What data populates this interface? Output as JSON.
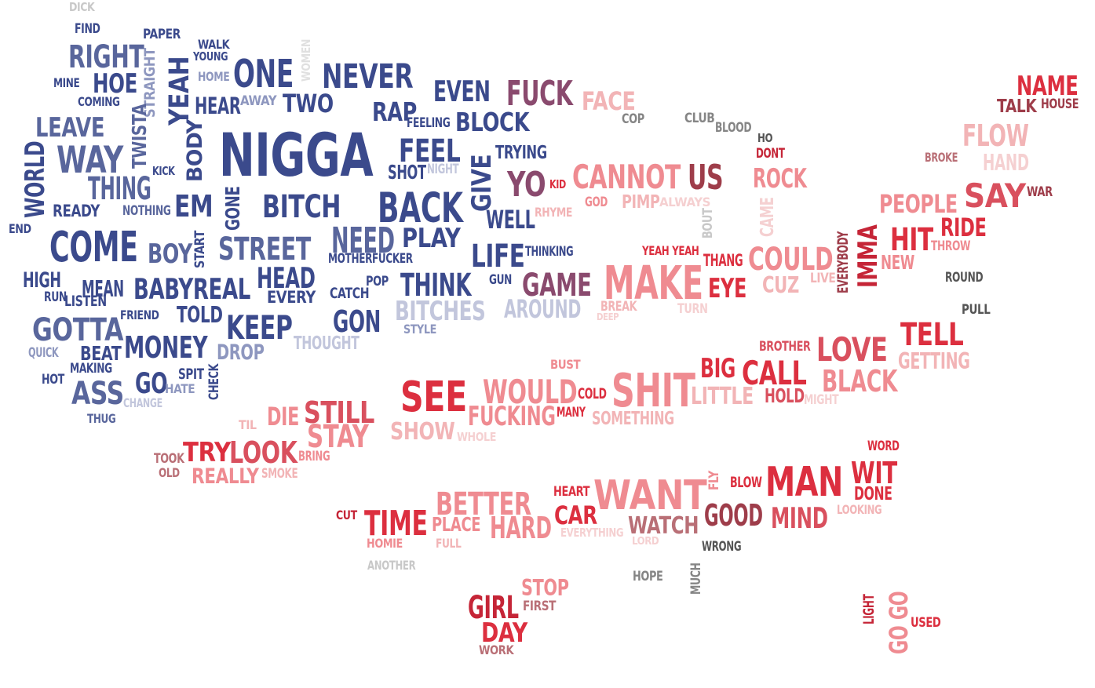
{
  "colors": {
    "navy": "#3b4a8c",
    "navy_mid": "#59669c",
    "navy_light": "#8e97bf",
    "navy_pale": "#c2c6dc",
    "plum": "#8a4a6e",
    "red": "#dc2f3f",
    "crimson": "#c52537",
    "red_mid": "#d9505e",
    "pink": "#ef8b91",
    "pink_light": "#f2b4b6",
    "pink_pale": "#f5d0d1",
    "maroon": "#9e3d4a",
    "rose_gray": "#b96f76",
    "gray": "#858585",
    "gray_dark": "#555555",
    "gray_light": "#c8c8c8",
    "gray_pale": "#e0e0e0"
  },
  "words": [
    {
      "id": "dick",
      "text": "DICK",
      "c": "gray_light"
    },
    {
      "id": "find",
      "text": "FIND",
      "c": "navy"
    },
    {
      "id": "paper",
      "text": "PAPER",
      "c": "navy"
    },
    {
      "id": "walk",
      "text": "WALK",
      "c": "navy"
    },
    {
      "id": "young",
      "text": "YOUNG",
      "c": "navy"
    },
    {
      "id": "right",
      "text": "RIGHT",
      "c": "navy_mid"
    },
    {
      "id": "straight",
      "text": "STRAIGHT",
      "c": "navy_light"
    },
    {
      "id": "women",
      "text": "WOMEN",
      "c": "gray_pale"
    },
    {
      "id": "one",
      "text": "ONE",
      "c": "navy"
    },
    {
      "id": "never",
      "text": "NEVER",
      "c": "navy"
    },
    {
      "id": "mine",
      "text": "MINE",
      "c": "navy"
    },
    {
      "id": "hoe",
      "text": "HOE",
      "c": "navy"
    },
    {
      "id": "yeah",
      "text": "YEAH",
      "c": "navy"
    },
    {
      "id": "home",
      "text": "HOME",
      "c": "navy_light"
    },
    {
      "id": "even",
      "text": "EVEN",
      "c": "navy"
    },
    {
      "id": "fuck",
      "text": "FUCK",
      "c": "plum"
    },
    {
      "id": "face",
      "text": "FACE",
      "c": "pink_light"
    },
    {
      "id": "name",
      "text": "NAME",
      "c": "red"
    },
    {
      "id": "coming",
      "text": "COMING",
      "c": "navy"
    },
    {
      "id": "hear",
      "text": "HEAR",
      "c": "navy"
    },
    {
      "id": "away",
      "text": "AWAY",
      "c": "navy_light"
    },
    {
      "id": "two",
      "text": "TWO",
      "c": "navy"
    },
    {
      "id": "rap",
      "text": "RAP",
      "c": "navy"
    },
    {
      "id": "talk",
      "text": "TALK",
      "c": "maroon"
    },
    {
      "id": "house",
      "text": "HOUSE",
      "c": "maroon"
    },
    {
      "id": "leave",
      "text": "LEAVE",
      "c": "navy_mid"
    },
    {
      "id": "twista",
      "text": "TWISTA",
      "c": "navy_mid"
    },
    {
      "id": "body",
      "text": "BODY",
      "c": "navy"
    },
    {
      "id": "feeling",
      "text": "FEELING",
      "c": "navy"
    },
    {
      "id": "block",
      "text": "BLOCK",
      "c": "navy"
    },
    {
      "id": "cop",
      "text": "COP",
      "c": "gray"
    },
    {
      "id": "club",
      "text": "CLUB",
      "c": "gray"
    },
    {
      "id": "blood",
      "text": "BLOOD",
      "c": "gray"
    },
    {
      "id": "nigga",
      "text": "NIGGA",
      "c": "navy"
    },
    {
      "id": "ho",
      "text": "HO",
      "c": "gray_dark"
    },
    {
      "id": "flow",
      "text": "FLOW",
      "c": "pink_light"
    },
    {
      "id": "world",
      "text": "WORLD",
      "c": "navy"
    },
    {
      "id": "way",
      "text": "WAY",
      "c": "navy_mid"
    },
    {
      "id": "feel",
      "text": "FEEL",
      "c": "navy"
    },
    {
      "id": "trying",
      "text": "TRYING",
      "c": "navy"
    },
    {
      "id": "dont",
      "text": "DONT",
      "c": "crimson"
    },
    {
      "id": "broke",
      "text": "BROKE",
      "c": "rose_gray"
    },
    {
      "id": "kick",
      "text": "KICK",
      "c": "navy"
    },
    {
      "id": "shot",
      "text": "SHOT",
      "c": "navy"
    },
    {
      "id": "night",
      "text": "NIGHT",
      "c": "navy_pale"
    },
    {
      "id": "hand",
      "text": "HAND",
      "c": "pink_pale"
    },
    {
      "id": "thing",
      "text": "THING",
      "c": "navy_mid"
    },
    {
      "id": "give",
      "text": "GIVE",
      "c": "navy"
    },
    {
      "id": "cannot",
      "text": "CANNOT",
      "c": "pink"
    },
    {
      "id": "us",
      "text": "US",
      "c": "maroon"
    },
    {
      "id": "rock",
      "text": "ROCK",
      "c": "pink"
    },
    {
      "id": "yo",
      "text": "YO",
      "c": "plum"
    },
    {
      "id": "kid",
      "text": "KID",
      "c": "red"
    },
    {
      "id": "say",
      "text": "SAY",
      "c": "red_mid"
    },
    {
      "id": "war",
      "text": "WAR",
      "c": "maroon"
    },
    {
      "id": "em",
      "text": "EM",
      "c": "navy"
    },
    {
      "id": "gone",
      "text": "GONE",
      "c": "navy"
    },
    {
      "id": "bitch",
      "text": "BITCH",
      "c": "navy"
    },
    {
      "id": "back",
      "text": "BACK",
      "c": "navy"
    },
    {
      "id": "god",
      "text": "GOD",
      "c": "pink"
    },
    {
      "id": "pimp",
      "text": "PIMP",
      "c": "pink_light"
    },
    {
      "id": "always",
      "text": "ALWAYS",
      "c": "pink_pale"
    },
    {
      "id": "people",
      "text": "PEOPLE",
      "c": "pink"
    },
    {
      "id": "ready",
      "text": "READY",
      "c": "navy"
    },
    {
      "id": "nothing",
      "text": "NOTHING",
      "c": "navy_mid"
    },
    {
      "id": "well",
      "text": "WELL",
      "c": "navy"
    },
    {
      "id": "rhyme",
      "text": "RHYME",
      "c": "pink_light"
    },
    {
      "id": "bout",
      "text": "BOUT",
      "c": "gray_light"
    },
    {
      "id": "came",
      "text": "CAME",
      "c": "pink_pale"
    },
    {
      "id": "ride",
      "text": "RIDE",
      "c": "red"
    },
    {
      "id": "end",
      "text": "END",
      "c": "navy"
    },
    {
      "id": "come",
      "text": "COME",
      "c": "navy"
    },
    {
      "id": "start",
      "text": "START",
      "c": "navy"
    },
    {
      "id": "street",
      "text": "STREET",
      "c": "navy_mid"
    },
    {
      "id": "need",
      "text": "NEED",
      "c": "navy_mid"
    },
    {
      "id": "play",
      "text": "PLAY",
      "c": "navy"
    },
    {
      "id": "everybody",
      "text": "EVERYBODY",
      "c": "maroon"
    },
    {
      "id": "imma",
      "text": "IMMA",
      "c": "crimson"
    },
    {
      "id": "hit",
      "text": "HIT",
      "c": "red"
    },
    {
      "id": "throw",
      "text": "THROW",
      "c": "pink"
    },
    {
      "id": "boy",
      "text": "BOY",
      "c": "navy_mid"
    },
    {
      "id": "life",
      "text": "LIFE",
      "c": "navy"
    },
    {
      "id": "thinking",
      "text": "THINKING",
      "c": "navy"
    },
    {
      "id": "yeah_yeah",
      "text": "YEAH YEAH",
      "c": "red"
    },
    {
      "id": "thang",
      "text": "THANG",
      "c": "red"
    },
    {
      "id": "could",
      "text": "COULD",
      "c": "pink"
    },
    {
      "id": "new",
      "text": "NEW",
      "c": "pink"
    },
    {
      "id": "motherfucker",
      "text": "MOTHERFUCKER",
      "c": "navy"
    },
    {
      "id": "head",
      "text": "HEAD",
      "c": "navy"
    },
    {
      "id": "high",
      "text": "HIGH",
      "c": "navy"
    },
    {
      "id": "mean",
      "text": "MEAN",
      "c": "navy"
    },
    {
      "id": "babyreal",
      "text": "BABYREAL",
      "c": "navy"
    },
    {
      "id": "pop",
      "text": "POP",
      "c": "navy"
    },
    {
      "id": "think",
      "text": "THINK",
      "c": "navy"
    },
    {
      "id": "gun",
      "text": "GUN",
      "c": "navy"
    },
    {
      "id": "game",
      "text": "GAME",
      "c": "plum"
    },
    {
      "id": "make",
      "text": "MAKE",
      "c": "pink"
    },
    {
      "id": "eye",
      "text": "EYE",
      "c": "red"
    },
    {
      "id": "cuz",
      "text": "CUZ",
      "c": "pink_light"
    },
    {
      "id": "live",
      "text": "LIVE",
      "c": "pink_light"
    },
    {
      "id": "round",
      "text": "ROUND",
      "c": "gray_dark"
    },
    {
      "id": "run",
      "text": "RUN",
      "c": "navy"
    },
    {
      "id": "listen",
      "text": "LISTEN",
      "c": "navy"
    },
    {
      "id": "every",
      "text": "EVERY",
      "c": "navy"
    },
    {
      "id": "catch",
      "text": "CATCH",
      "c": "navy"
    },
    {
      "id": "bitches",
      "text": "BITCHES",
      "c": "navy_pale"
    },
    {
      "id": "around",
      "text": "AROUND",
      "c": "navy_pale"
    },
    {
      "id": "break",
      "text": "BREAK",
      "c": "pink_light"
    },
    {
      "id": "turn",
      "text": "TURN",
      "c": "pink_pale"
    },
    {
      "id": "deep",
      "text": "DEEP",
      "c": "pink_pale"
    },
    {
      "id": "pull",
      "text": "PULL",
      "c": "gray_dark"
    },
    {
      "id": "friend",
      "text": "FRIEND",
      "c": "navy"
    },
    {
      "id": "gotta",
      "text": "GOTTA",
      "c": "navy_mid"
    },
    {
      "id": "told",
      "text": "TOLD",
      "c": "navy"
    },
    {
      "id": "keep",
      "text": "KEEP",
      "c": "navy"
    },
    {
      "id": "gon",
      "text": "GON",
      "c": "navy"
    },
    {
      "id": "style",
      "text": "STYLE",
      "c": "navy_light"
    },
    {
      "id": "tell",
      "text": "TELL",
      "c": "red"
    },
    {
      "id": "quick",
      "text": "QUICK",
      "c": "navy_light"
    },
    {
      "id": "beat",
      "text": "BEAT",
      "c": "navy"
    },
    {
      "id": "money",
      "text": "MONEY",
      "c": "navy"
    },
    {
      "id": "drop",
      "text": "DROP",
      "c": "navy_light"
    },
    {
      "id": "thought",
      "text": "THOUGHT",
      "c": "navy_pale"
    },
    {
      "id": "brother",
      "text": "BROTHER",
      "c": "red_mid"
    },
    {
      "id": "love",
      "text": "LOVE",
      "c": "red_mid"
    },
    {
      "id": "getting",
      "text": "GETTING",
      "c": "pink_light"
    },
    {
      "id": "making",
      "text": "MAKING",
      "c": "navy"
    },
    {
      "id": "spit",
      "text": "SPIT",
      "c": "navy"
    },
    {
      "id": "check",
      "text": "CHECK",
      "c": "navy"
    },
    {
      "id": "bust",
      "text": "BUST",
      "c": "pink"
    },
    {
      "id": "big",
      "text": "BIG",
      "c": "red"
    },
    {
      "id": "call",
      "text": "CALL",
      "c": "red"
    },
    {
      "id": "hot",
      "text": "HOT",
      "c": "navy"
    },
    {
      "id": "go",
      "text": "GO",
      "c": "navy"
    },
    {
      "id": "hate",
      "text": "HATE",
      "c": "navy_light"
    },
    {
      "id": "ass",
      "text": "ASS",
      "c": "navy_mid"
    },
    {
      "id": "see",
      "text": "SEE",
      "c": "red"
    },
    {
      "id": "would",
      "text": "WOULD",
      "c": "pink"
    },
    {
      "id": "cold",
      "text": "COLD",
      "c": "red"
    },
    {
      "id": "shit",
      "text": "SHIT",
      "c": "pink"
    },
    {
      "id": "little",
      "text": "LITTLE",
      "c": "pink_light"
    },
    {
      "id": "hold",
      "text": "HOLD",
      "c": "red_mid"
    },
    {
      "id": "might",
      "text": "MIGHT",
      "c": "pink_pale"
    },
    {
      "id": "black",
      "text": "BLACK",
      "c": "pink"
    },
    {
      "id": "change",
      "text": "CHANGE",
      "c": "navy_pale"
    },
    {
      "id": "thug",
      "text": "THUG",
      "c": "navy_mid"
    },
    {
      "id": "die",
      "text": "DIE",
      "c": "pink"
    },
    {
      "id": "still",
      "text": "STILL",
      "c": "red_mid"
    },
    {
      "id": "fucking",
      "text": "FUCKING",
      "c": "pink"
    },
    {
      "id": "many",
      "text": "MANY",
      "c": "red"
    },
    {
      "id": "something",
      "text": "SOMETHING",
      "c": "pink_light"
    },
    {
      "id": "til",
      "text": "TIL",
      "c": "pink_light"
    },
    {
      "id": "show",
      "text": "SHOW",
      "c": "pink_light"
    },
    {
      "id": "whole",
      "text": "WHOLE",
      "c": "pink_pale"
    },
    {
      "id": "stay",
      "text": "STAY",
      "c": "pink"
    },
    {
      "id": "took",
      "text": "TOOK",
      "c": "rose_gray"
    },
    {
      "id": "try",
      "text": "TRY",
      "c": "red"
    },
    {
      "id": "look",
      "text": "LOOK",
      "c": "red_mid"
    },
    {
      "id": "bring",
      "text": "BRING",
      "c": "pink"
    },
    {
      "id": "old",
      "text": "OLD",
      "c": "rose_gray"
    },
    {
      "id": "really",
      "text": "REALLY",
      "c": "pink"
    },
    {
      "id": "smoke",
      "text": "SMOKE",
      "c": "pink_light"
    },
    {
      "id": "word",
      "text": "WORD",
      "c": "red"
    },
    {
      "id": "wit",
      "text": "WIT",
      "c": "red"
    },
    {
      "id": "fly",
      "text": "FLY",
      "c": "pink"
    },
    {
      "id": "blow",
      "text": "BLOW",
      "c": "red"
    },
    {
      "id": "man",
      "text": "MAN",
      "c": "red"
    },
    {
      "id": "done",
      "text": "DONE",
      "c": "red"
    },
    {
      "id": "heart",
      "text": "HEART",
      "c": "red"
    },
    {
      "id": "better",
      "text": "BETTER",
      "c": "pink"
    },
    {
      "id": "want",
      "text": "WANT",
      "c": "pink"
    },
    {
      "id": "looking",
      "text": "LOOKING",
      "c": "pink_light"
    },
    {
      "id": "cut",
      "text": "CUT",
      "c": "crimson"
    },
    {
      "id": "time",
      "text": "TIME",
      "c": "red"
    },
    {
      "id": "place",
      "text": "PLACE",
      "c": "pink"
    },
    {
      "id": "hard",
      "text": "HARD",
      "c": "pink"
    },
    {
      "id": "car",
      "text": "CAR",
      "c": "red"
    },
    {
      "id": "watch",
      "text": "WATCH",
      "c": "rose_gray"
    },
    {
      "id": "good",
      "text": "GOOD",
      "c": "maroon"
    },
    {
      "id": "mind",
      "text": "MIND",
      "c": "red_mid"
    },
    {
      "id": "everything",
      "text": "EVERYTHING",
      "c": "pink_pale"
    },
    {
      "id": "lord",
      "text": "LORD",
      "c": "pink_pale"
    },
    {
      "id": "homie",
      "text": "HOMIE",
      "c": "pink"
    },
    {
      "id": "full",
      "text": "FULL",
      "c": "pink_light"
    },
    {
      "id": "wrong",
      "text": "WRONG",
      "c": "gray_dark"
    },
    {
      "id": "another",
      "text": "ANOTHER",
      "c": "gray_light"
    },
    {
      "id": "hope",
      "text": "HOPE",
      "c": "gray"
    },
    {
      "id": "much",
      "text": "MUCH",
      "c": "gray"
    },
    {
      "id": "stop",
      "text": "STOP",
      "c": "pink"
    },
    {
      "id": "first",
      "text": "FIRST",
      "c": "rose_gray"
    },
    {
      "id": "girl",
      "text": "GIRL",
      "c": "crimson"
    },
    {
      "id": "day",
      "text": "DAY",
      "c": "red"
    },
    {
      "id": "work",
      "text": "WORK",
      "c": "rose_gray"
    },
    {
      "id": "light",
      "text": "LIGHT",
      "c": "crimson"
    },
    {
      "id": "go_go",
      "text": "GO GO",
      "c": "pink"
    },
    {
      "id": "used",
      "text": "USED",
      "c": "red"
    }
  ]
}
